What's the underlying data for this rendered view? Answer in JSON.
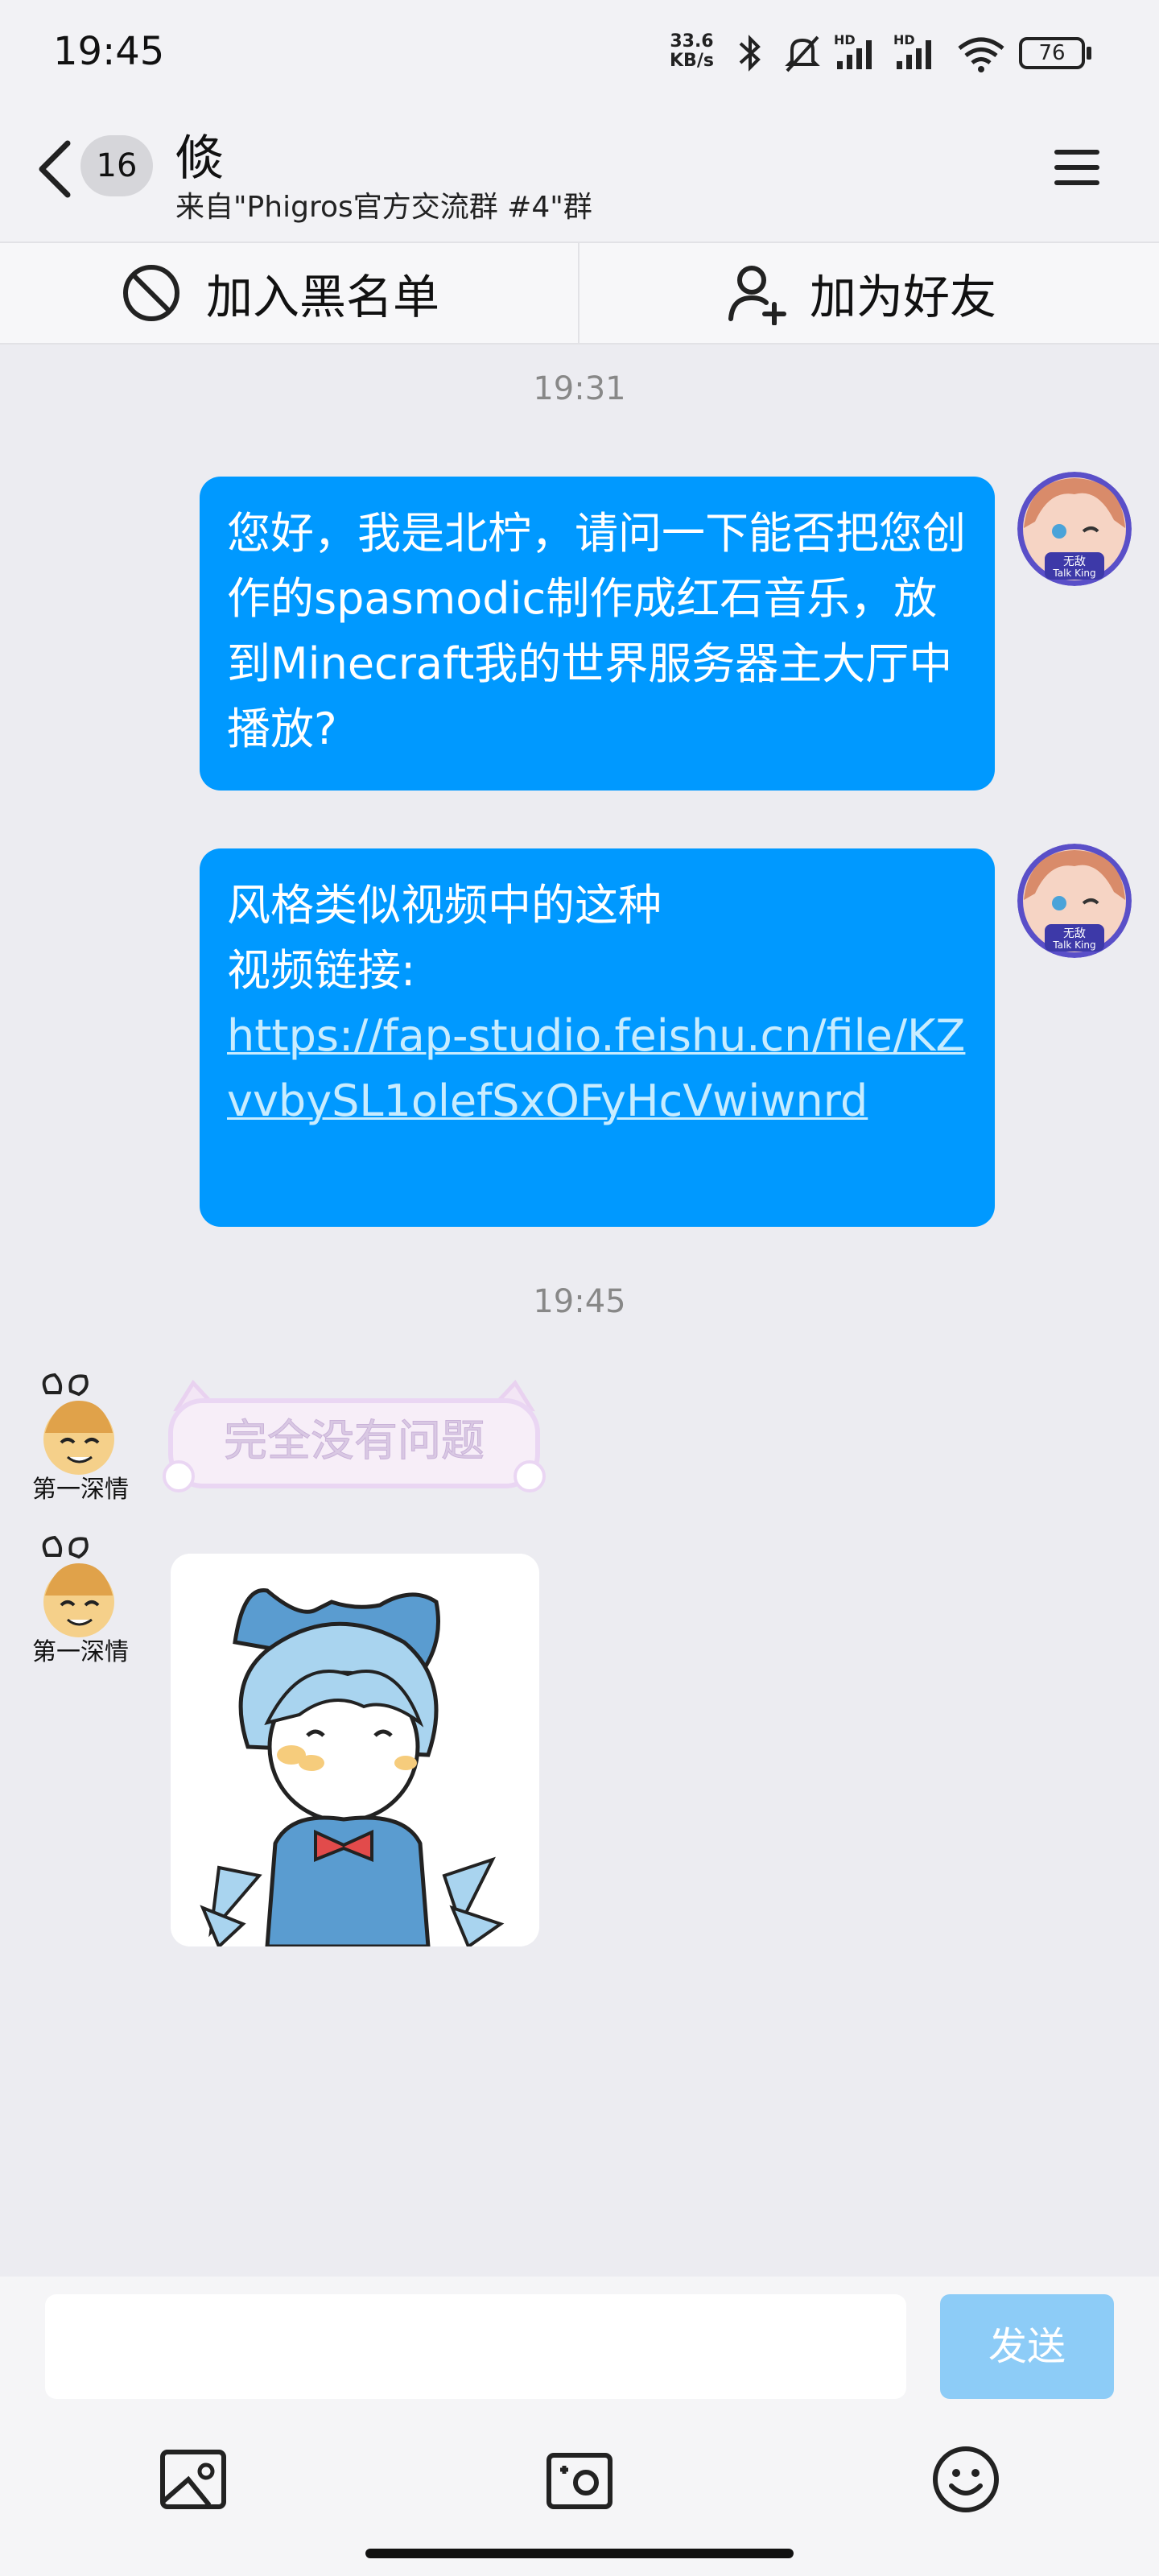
{
  "status_bar": {
    "time": "19:45",
    "net_speed_value": "33.6",
    "net_speed_unit": "KB/s",
    "hd_label_1": "HD",
    "hd_label_2": "HD",
    "battery": "76",
    "icons": [
      "bluetooth-icon",
      "mute-bell-icon",
      "signal-icon",
      "signal-icon",
      "wifi-icon",
      "battery-icon"
    ]
  },
  "header": {
    "unread_count": "16",
    "title": "倐",
    "subtitle": "来自\"Phigros官方交流群 #4\"群"
  },
  "actions": {
    "blacklist_label": "加入黑名单",
    "add_friend_label": "加为好友"
  },
  "messages": [
    {
      "type": "timestamp",
      "text": "19:31"
    },
    {
      "type": "outgoing",
      "text": "您好，我是北柠，请问一下能否把您创作的spasmodic制作成红石音乐，放到Minecraft我的世界服务器主大厅中播放?"
    },
    {
      "type": "outgoing",
      "line1": "风格类似视频中的这种",
      "line2": "视频链接:",
      "link": "https://fap-studio.feishu.cn/file/KZvvbySL1olefSxOFyHcVwiwnrd"
    },
    {
      "type": "timestamp",
      "text": "19:45"
    },
    {
      "type": "incoming-sticker",
      "text": "完全没有问题",
      "avatar_text": "第一深情"
    },
    {
      "type": "incoming-image",
      "avatar_text": "第一深情"
    }
  ],
  "self_avatar_text": "无敌 Talk King",
  "composer": {
    "input_value": "",
    "send_label": "发送"
  },
  "colors": {
    "bubble_out": "#0099ff",
    "send_disabled": "#8dccf7",
    "chat_bg": "#ececf1"
  }
}
